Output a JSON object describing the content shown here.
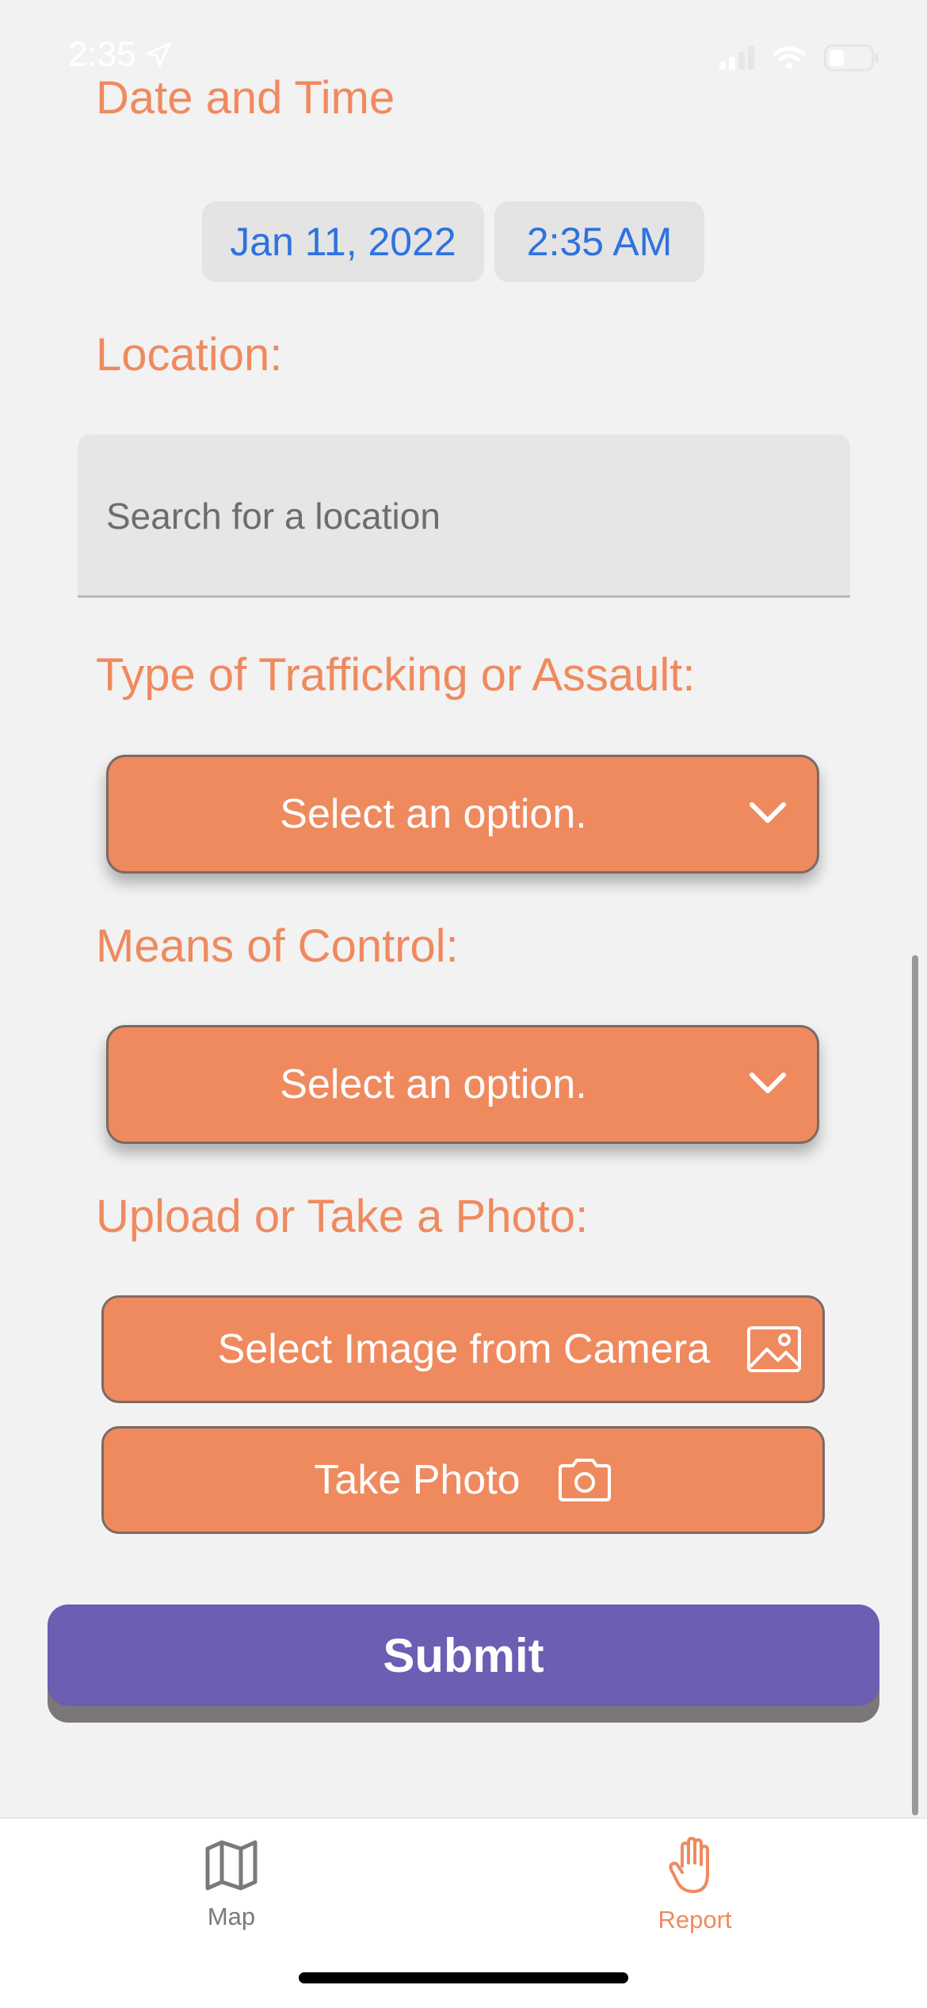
{
  "status_bar": {
    "time": "2:35"
  },
  "date_time": {
    "label": "Date and Time",
    "date_value": "Jan 11, 2022",
    "time_value": "2:35 AM"
  },
  "location": {
    "label": "Location:",
    "placeholder": "Search for a location"
  },
  "trafficking_type": {
    "label": "Type of Trafficking or Assault:",
    "selected": "Select an option."
  },
  "means_of_control": {
    "label": "Means of Control:",
    "selected": "Select an option."
  },
  "photo": {
    "label": "Upload or Take a Photo:",
    "select_image_label": "Select Image from Camera",
    "take_photo_label": "Take Photo"
  },
  "submit": {
    "label": "Submit"
  },
  "tab_bar": {
    "tabs": [
      {
        "label": "Map",
        "icon": "map-icon",
        "active": false
      },
      {
        "label": "Report",
        "icon": "hand-icon",
        "active": true
      }
    ]
  },
  "colors": {
    "accent": "#ef8a5f",
    "link_blue": "#2f72e0",
    "submit": "#6b5eb3",
    "inactive_tab": "#7a7a7a"
  }
}
